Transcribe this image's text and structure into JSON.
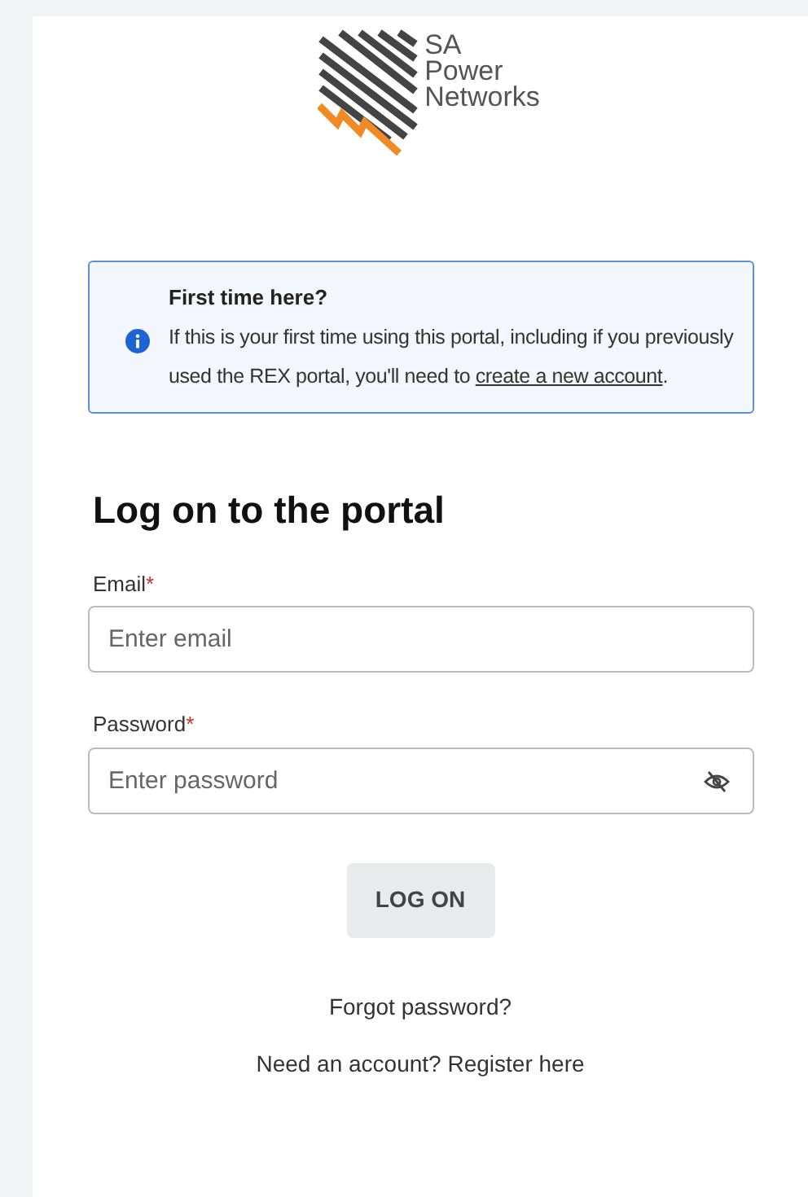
{
  "logo": {
    "lines": [
      "SA",
      "Power",
      "Networks"
    ]
  },
  "notice": {
    "title": "First time here?",
    "text_before": "If this is your first time using this portal, including if you previously used the REX portal, you'll need to ",
    "link": "create a new account",
    "text_after": "."
  },
  "heading": "Log on to the portal",
  "fields": [
    {
      "label": "Email",
      "required_mark": "*",
      "placeholder": "Enter email",
      "kind": "text"
    },
    {
      "label": "Password",
      "required_mark": "*",
      "placeholder": "Enter password",
      "kind": "password"
    }
  ],
  "button": "LOG ON",
  "links": [
    "Forgot password?",
    "Need an account? Register here"
  ]
}
